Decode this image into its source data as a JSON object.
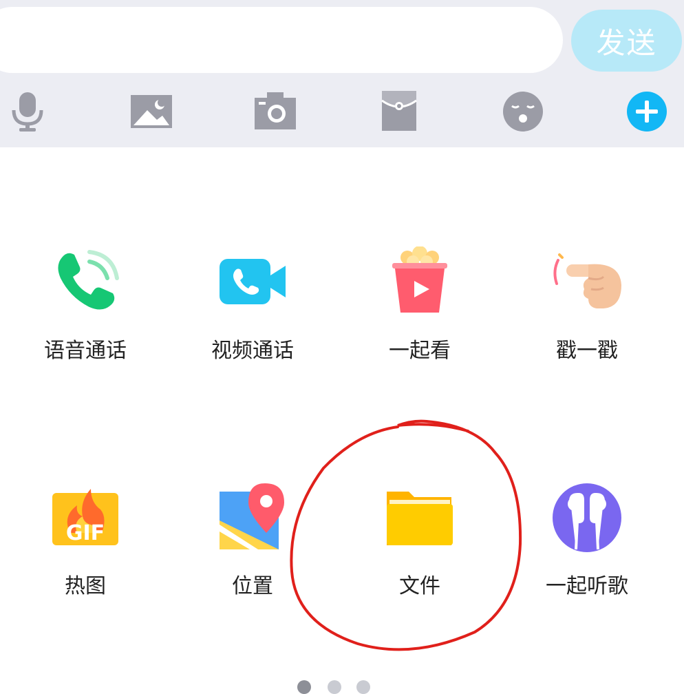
{
  "input_bar": {
    "message_value": "",
    "send_label": "发送"
  },
  "toolbar": {
    "icons": [
      "microphone-icon",
      "image-icon",
      "camera-icon",
      "red-packet-icon",
      "emoji-icon",
      "plus-icon"
    ],
    "accent_color": "#12b7f5",
    "icon_color": "#9b9ca6"
  },
  "panel": {
    "items": [
      {
        "label": "语音通话",
        "icon": "phone-call-icon"
      },
      {
        "label": "视频通话",
        "icon": "video-call-icon"
      },
      {
        "label": "一起看",
        "icon": "popcorn-icon"
      },
      {
        "label": "戳一戳",
        "icon": "poke-finger-icon"
      },
      {
        "label": "热图",
        "icon": "gif-icon"
      },
      {
        "label": "位置",
        "icon": "location-map-icon"
      },
      {
        "label": "文件",
        "icon": "folder-icon"
      },
      {
        "label": "一起听歌",
        "icon": "earphones-icon"
      }
    ],
    "page_count": 3,
    "current_page": 1
  },
  "annotation": {
    "highlighted_item": "文件",
    "color": "#e0201b"
  }
}
